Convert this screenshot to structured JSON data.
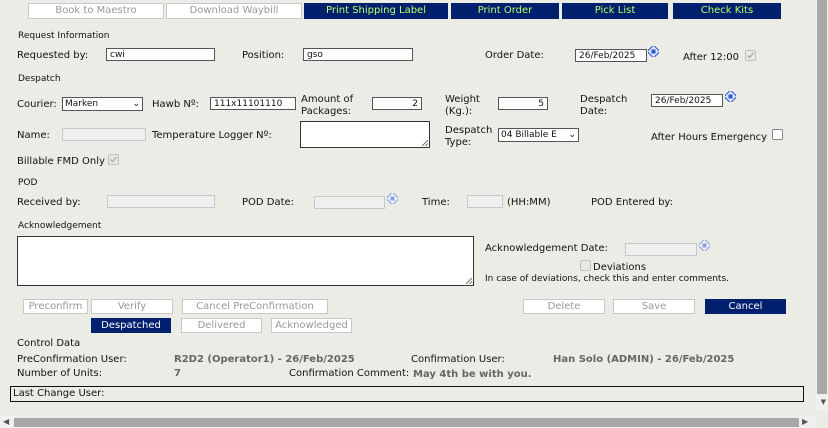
{
  "toolbar": {
    "book_to_maestro": "Book to Maestro",
    "download_waybill": "Download Waybill",
    "print_shipping_label": "Print Shipping Label",
    "print_order": "Print Order",
    "pick_list": "Pick List",
    "check_kits": "Check Kits"
  },
  "request_info": {
    "section_title": "Request Information",
    "requested_by_label": "Requested by:",
    "requested_by_value": "cwi",
    "position_label": "Position:",
    "position_value": "gso",
    "order_date_label": "Order Date:",
    "order_date_value": "26/Feb/2025",
    "after_12_label": "After 12:00"
  },
  "despatch": {
    "section_title": "Despatch",
    "courier_label": "Courier:",
    "courier_value": "Marken",
    "hawb_label": "Hawb Nº:",
    "hawb_value": "111x11101110",
    "amount_label_1": "Amount of",
    "amount_label_2": "Packages:",
    "amount_value": "2",
    "weight_label_1": "Weight",
    "weight_label_2": "(Kg.):",
    "weight_value": "5",
    "despatch_date_label_1": "Despatch",
    "despatch_date_label_2": "Date:",
    "despatch_date_value": "26/Feb/2025",
    "name_label": "Name:",
    "temp_logger_label": "Temperature Logger Nº:",
    "despatch_type_label_1": "Despatch",
    "despatch_type_label_2": "Type:",
    "despatch_type_value": "04 Billable E",
    "after_hours_label": "After Hours Emergency",
    "billable_fmd_label": "Billable FMD Only"
  },
  "pod": {
    "section_title": "POD",
    "received_by_label": "Received by:",
    "pod_date_label": "POD Date:",
    "time_label": "Time:",
    "time_hint": "(HH:MM)",
    "pod_entered_by_label": "POD Entered by:"
  },
  "acknowledgement": {
    "section_title": "Acknowledgement",
    "ack_date_label": "Acknowledgement Date:",
    "deviations_label": "Deviations",
    "deviations_hint": "In case of deviations, check this and enter comments."
  },
  "actions": {
    "preconfirm": "Preconfirm",
    "verify": "Verify",
    "cancel_preconfirmation": "Cancel PreConfirmation",
    "delete": "Delete",
    "save": "Save",
    "cancel": "Cancel"
  },
  "status": {
    "despatched": "Despatched",
    "delivered": "Delivered",
    "acknowledged": "Acknowledged"
  },
  "control": {
    "section_title": "Control Data",
    "preconf_user_label": "PreConfirmation User:",
    "preconf_user_value": "R2D2 (Operator1) - 26/Feb/2025",
    "conf_user_label": "Confirmation User:",
    "conf_user_value": "Han Solo (ADMIN) - 26/Feb/2025",
    "num_units_label": "Number of Units:",
    "num_units_value": "7",
    "conf_comment_label": "Confirmation Comment:",
    "conf_comment_value": "May 4th be with you.",
    "last_change_label": "Last Change User:"
  },
  "colors": {
    "dark_button": "#00206e",
    "dark_button_text": "#b6ff6c"
  }
}
